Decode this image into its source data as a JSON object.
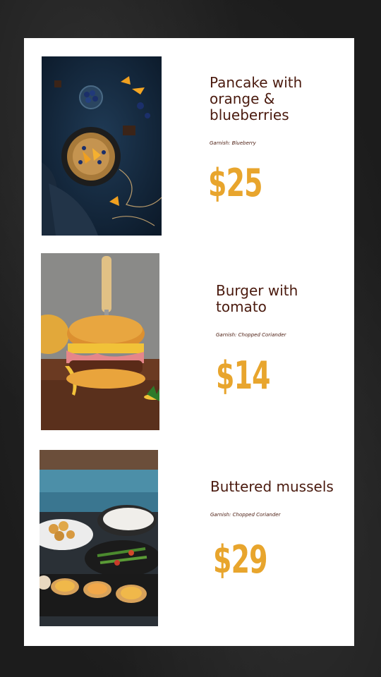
{
  "menu_items": [
    {
      "name": "Pancake with orange & blueberries",
      "garnish": "Garnish: Blueberry",
      "price": "$25",
      "photo_icon": "pancake-photo"
    },
    {
      "name": "Burger with tomato",
      "garnish": "Garnish: Chopped Coriander",
      "price": "$14",
      "photo_icon": "burger-photo"
    },
    {
      "name": "Buttered mussels",
      "garnish": "Garnish: Chopped Coriander",
      "price": "$29",
      "photo_icon": "mussels-photo"
    }
  ],
  "colors": {
    "title": "#4a1a0e",
    "price": "#e8a52d",
    "background": "#242424",
    "card": "#ffffff"
  }
}
